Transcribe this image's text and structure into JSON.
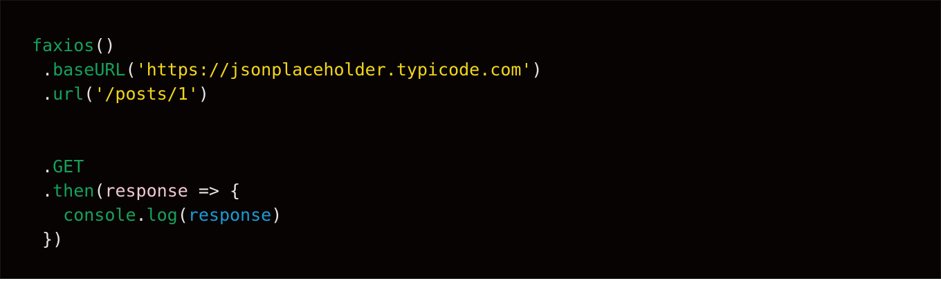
{
  "colors": {
    "background": "#070303",
    "function": "#16a05a",
    "string": "#f2d51b",
    "punctuation": "#e8e4e4",
    "parameter": "#f0c6d4",
    "variable": "#1a9ad6"
  },
  "code": {
    "lines": [
      {
        "tokens": [
          {
            "text": "faxios",
            "kind": "function"
          },
          {
            "text": "()",
            "kind": "punctuation"
          }
        ]
      },
      {
        "tokens": [
          {
            "text": " .",
            "kind": "punctuation"
          },
          {
            "text": "baseURL",
            "kind": "function"
          },
          {
            "text": "(",
            "kind": "punctuation"
          },
          {
            "text": "'https://jsonplaceholder.typicode.com'",
            "kind": "string"
          },
          {
            "text": ")",
            "kind": "punctuation"
          }
        ]
      },
      {
        "tokens": [
          {
            "text": " .",
            "kind": "punctuation"
          },
          {
            "text": "url",
            "kind": "function"
          },
          {
            "text": "(",
            "kind": "punctuation"
          },
          {
            "text": "'/posts/1'",
            "kind": "string"
          },
          {
            "text": ")",
            "kind": "punctuation"
          }
        ]
      },
      {
        "tokens": []
      },
      {
        "tokens": []
      },
      {
        "tokens": [
          {
            "text": " .",
            "kind": "punctuation"
          },
          {
            "text": "GET",
            "kind": "function"
          }
        ]
      },
      {
        "tokens": [
          {
            "text": " .",
            "kind": "punctuation"
          },
          {
            "text": "then",
            "kind": "function"
          },
          {
            "text": "(",
            "kind": "punctuation"
          },
          {
            "text": "response",
            "kind": "parameter"
          },
          {
            "text": " => {",
            "kind": "punctuation"
          }
        ]
      },
      {
        "tokens": [
          {
            "text": "   ",
            "kind": "punctuation"
          },
          {
            "text": "console",
            "kind": "function"
          },
          {
            "text": ".",
            "kind": "punctuation"
          },
          {
            "text": "log",
            "kind": "function"
          },
          {
            "text": "(",
            "kind": "punctuation"
          },
          {
            "text": "response",
            "kind": "variable"
          },
          {
            "text": ")",
            "kind": "punctuation"
          }
        ]
      },
      {
        "tokens": [
          {
            "text": " })",
            "kind": "punctuation"
          }
        ]
      }
    ]
  }
}
